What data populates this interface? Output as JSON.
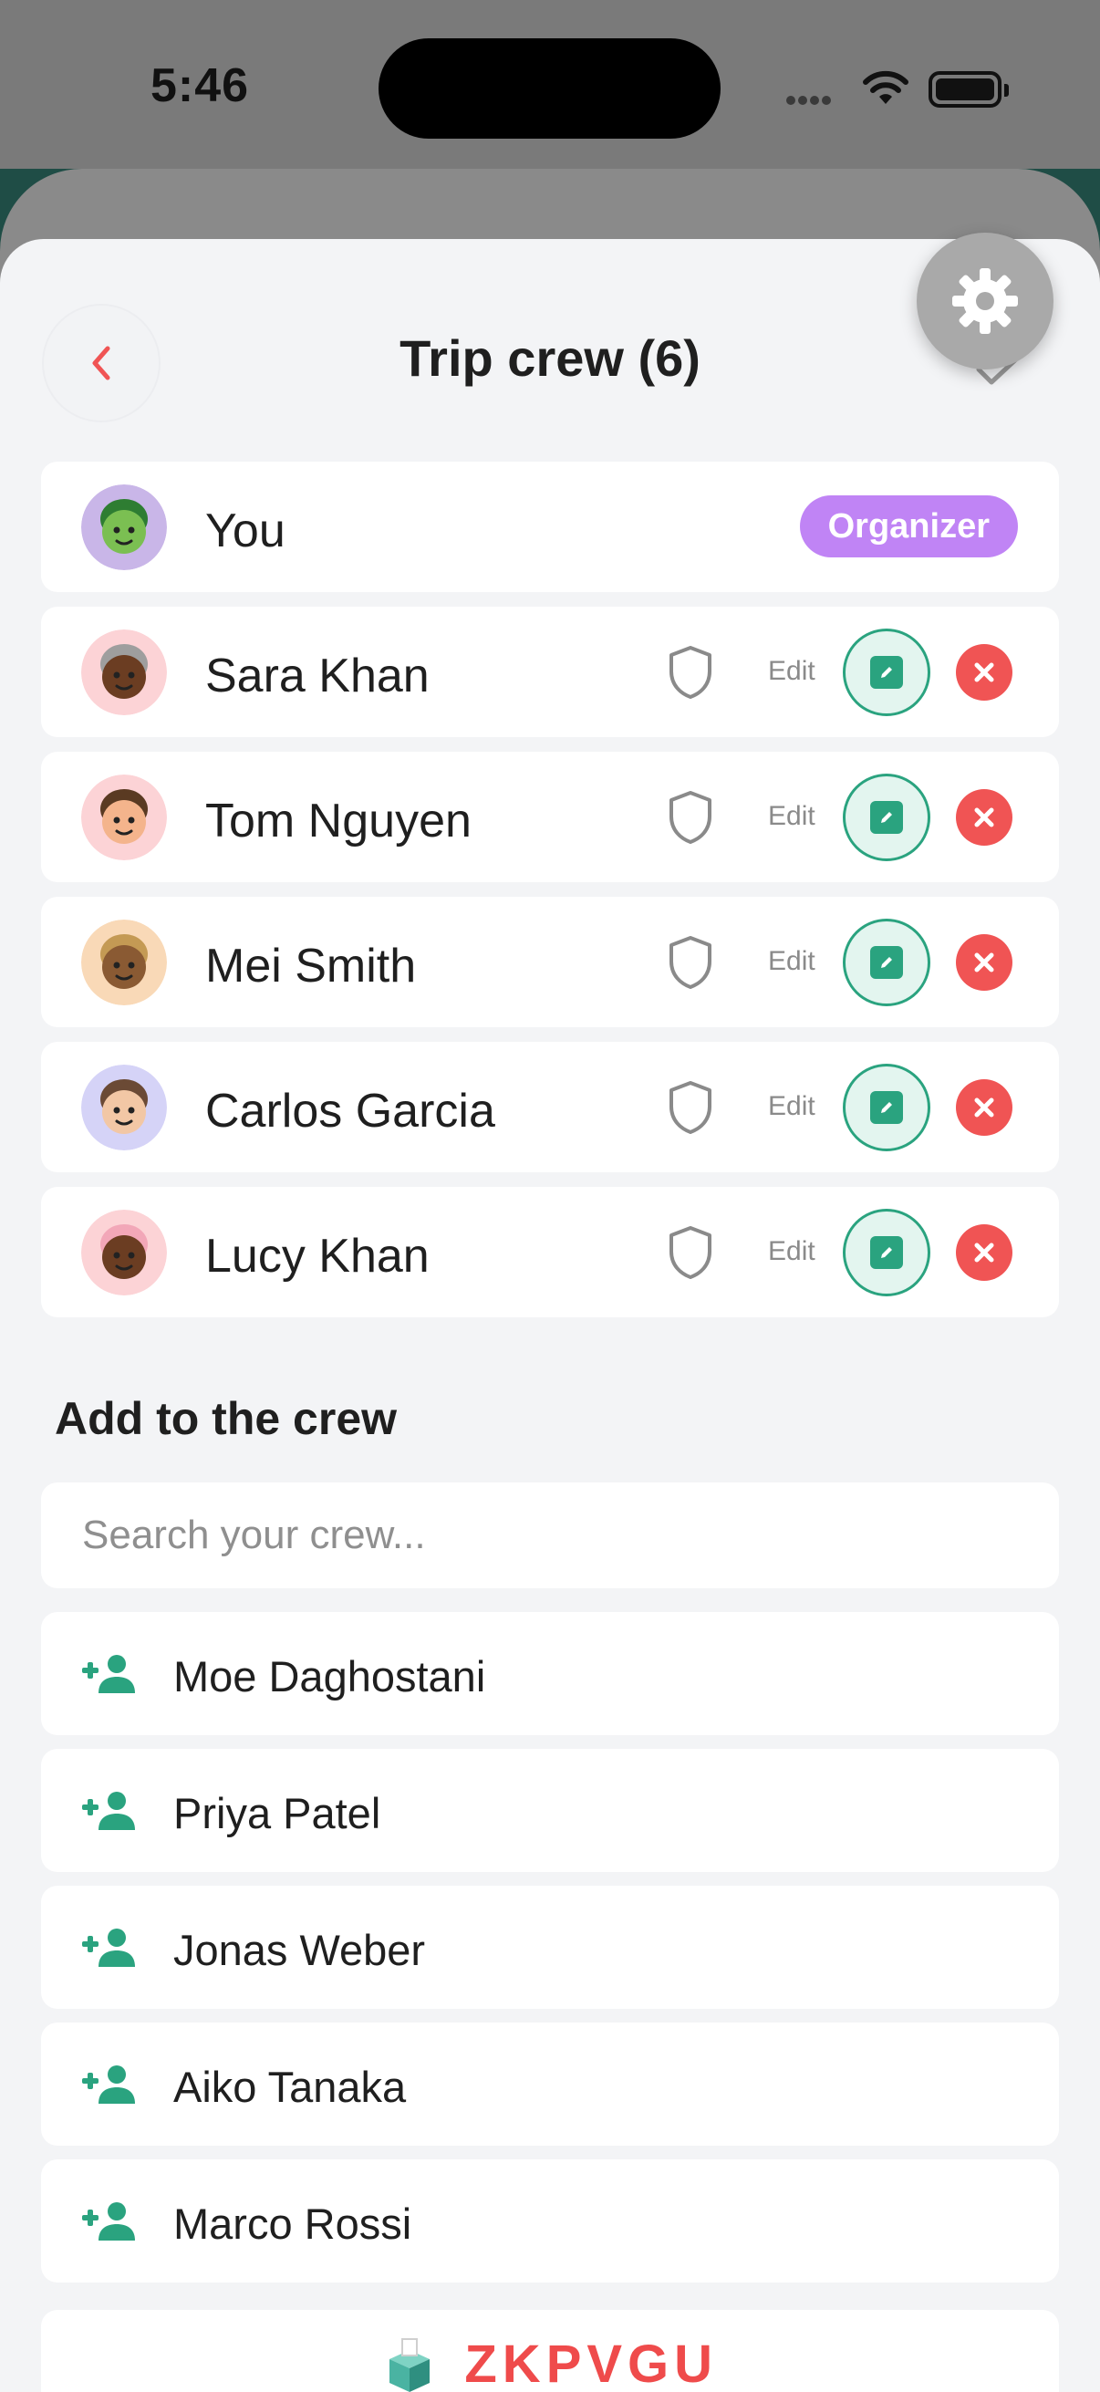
{
  "status_bar": {
    "time": "5:46"
  },
  "header": {
    "title": "Trip crew (6)"
  },
  "members": [
    {
      "name": "You",
      "badge": "Organizer",
      "avatar_bg": "#c9b6e8",
      "skin": "#7bbf52",
      "hair": "#2e7d32"
    },
    {
      "name": "Sara Khan",
      "edit_label": "Edit",
      "avatar_bg": "#fcd3d6",
      "skin": "#6b3d22",
      "hair": "#9e9e9e"
    },
    {
      "name": "Tom Nguyen",
      "edit_label": "Edit",
      "avatar_bg": "#fcd3d6",
      "skin": "#f4b48c",
      "hair": "#5a3a22"
    },
    {
      "name": "Mei Smith",
      "edit_label": "Edit",
      "avatar_bg": "#f9d9b7",
      "skin": "#8a5a33",
      "hair": "#c49a54"
    },
    {
      "name": "Carlos Garcia",
      "edit_label": "Edit",
      "avatar_bg": "#d5d3f7",
      "skin": "#f2c7a5",
      "hair": "#6b4a35"
    },
    {
      "name": "Lucy Khan",
      "edit_label": "Edit",
      "avatar_bg": "#fcd3d6",
      "skin": "#6b3d22",
      "hair": "#f2a7b8"
    }
  ],
  "add_section": {
    "title": "Add to the crew",
    "search_placeholder": "Search your crew..."
  },
  "candidates": [
    {
      "name": "Moe Daghostani"
    },
    {
      "name": "Priya Patel"
    },
    {
      "name": "Jonas Weber"
    },
    {
      "name": "Aiko Tanaka"
    },
    {
      "name": "Marco Rossi"
    }
  ],
  "invite": {
    "code": "ZKPVGU"
  },
  "colors": {
    "accent_green": "#2aa37f",
    "danger": "#f05454",
    "organizer": "#c084f5",
    "back_arrow": "#f05454"
  }
}
